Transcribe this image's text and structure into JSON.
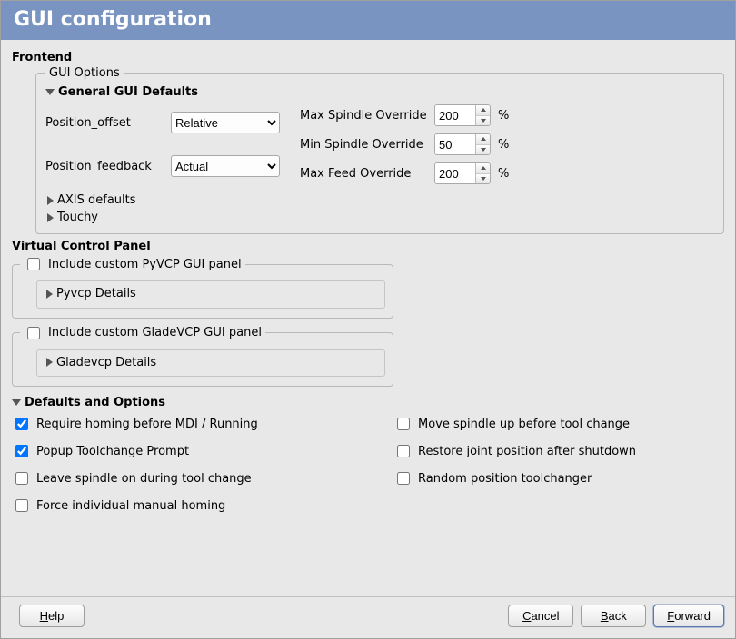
{
  "title": "GUI configuration",
  "frontend": {
    "heading": "Frontend",
    "gui_options_legend": "GUI Options",
    "general_defaults": {
      "label": "General GUI Defaults",
      "position_offset_label": "Position_offset",
      "position_offset_value": "Relative",
      "position_feedback_label": "Position_feedback",
      "position_feedback_value": "Actual",
      "max_spindle_label": "Max Spindle Override",
      "max_spindle_value": "200",
      "min_spindle_label": "Min Spindle Override",
      "min_spindle_value": "50",
      "max_feed_label": "Max Feed Override",
      "max_feed_value": "200",
      "percent": "%"
    },
    "axis_defaults_label": "AXIS defaults",
    "touchy_label": "Touchy"
  },
  "vcp": {
    "heading": "Virtual Control Panel",
    "pyvcp_check_label": "Include custom PyVCP GUI panel",
    "pyvcp_details_label": "Pyvcp Details",
    "gladevcp_check_label": "Include custom GladeVCP GUI panel",
    "gladevcp_details_label": "Gladevcp Details"
  },
  "defaults_options": {
    "heading": "Defaults and Options",
    "left": [
      {
        "label": "Require homing before MDI / Running",
        "checked": true
      },
      {
        "label": "Popup Toolchange Prompt",
        "checked": true
      },
      {
        "label": "Leave spindle on during tool change",
        "checked": false
      },
      {
        "label": "Force individual manual homing",
        "checked": false
      }
    ],
    "right": [
      {
        "label": "Move spindle up before tool change",
        "checked": false
      },
      {
        "label": "Restore joint position after shutdown",
        "checked": false
      },
      {
        "label": "Random position toolchanger",
        "checked": false
      }
    ]
  },
  "footer": {
    "help": "Help",
    "cancel": "Cancel",
    "back": "Back",
    "forward": "Forward"
  }
}
